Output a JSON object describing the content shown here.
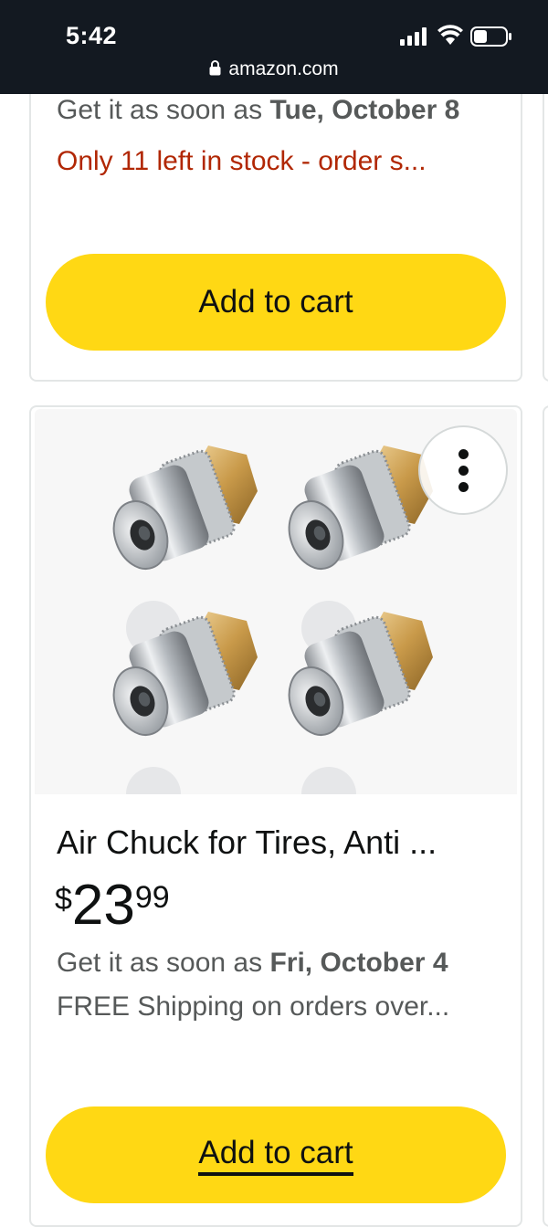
{
  "status_bar": {
    "time": "5:42",
    "url": "amazon.com"
  },
  "top_card": {
    "delivery_prefix": "Get it as soon as ",
    "delivery_date": "Tue, October 8",
    "stock_text": "Only 11 left in stock - order s...",
    "cart_label": "Add to cart"
  },
  "product_card": {
    "title": "Air Chuck for Tires, Anti ...",
    "price_currency": "$",
    "price_whole": "23",
    "price_fraction": "99",
    "delivery_prefix": "Get it as soon as ",
    "delivery_date": "Fri, October 4",
    "shipping_text": "FREE Shipping on orders over...",
    "cart_label": "Add to cart",
    "more_options_icon": "vertical-ellipsis-icon"
  },
  "colors": {
    "status_bar_bg": "#131921",
    "cart_button": "#ffd814",
    "stock_warning": "#b12704",
    "secondary_text": "#565959"
  }
}
